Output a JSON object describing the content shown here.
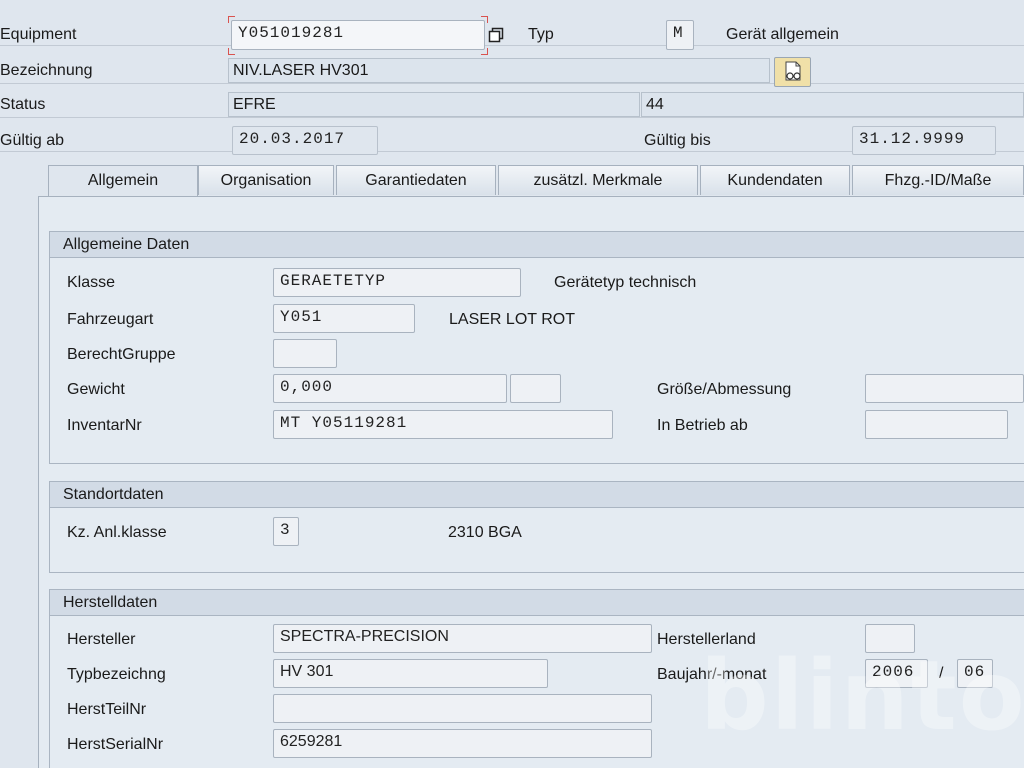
{
  "header": {
    "equipment_label": "Equipment",
    "equipment_value": "Y051019281",
    "typ_label": "Typ",
    "typ_value": "M",
    "typ_text": "Gerät allgemein",
    "bezeichnung_label": "Bezeichnung",
    "bezeichnung_value": "NIV.LASER HV301",
    "status_label": "Status",
    "status_value": "EFRE",
    "status_value2": "44",
    "gueltig_ab_label": "Gültig ab",
    "gueltig_ab_value": "20.03.2017",
    "gueltig_bis_label": "Gültig bis",
    "gueltig_bis_value": "31.12.9999"
  },
  "tabs": [
    {
      "label": "Allgemein",
      "active": true
    },
    {
      "label": "Organisation"
    },
    {
      "label": "Garantiedaten"
    },
    {
      "label": "zusätzl. Merkmale"
    },
    {
      "label": "Kundendaten"
    },
    {
      "label": "Fhzg.-ID/Maße"
    }
  ],
  "allgemeine_daten": {
    "title": "Allgemeine Daten",
    "klasse_label": "Klasse",
    "klasse_value": "GERAETETYP",
    "klasse_text": "Gerätetyp technisch",
    "fahrzeugart_label": "Fahrzeugart",
    "fahrzeugart_value": "Y051",
    "fahrzeugart_text": "LASER LOT ROT",
    "berechtgruppe_label": "BerechtGruppe",
    "berechtgruppe_value": "",
    "gewicht_label": "Gewicht",
    "gewicht_value": "0,000",
    "gewicht_unit": "",
    "groesse_label": "Größe/Abmessung",
    "groesse_value": "",
    "inventar_label": "InventarNr",
    "inventar_value": "MT Y05119281",
    "inbetrieb_label": "In Betrieb ab",
    "inbetrieb_value": ""
  },
  "standortdaten": {
    "title": "Standortdaten",
    "anlklasse_label": "Kz. Anl.klasse",
    "anlklasse_value": "3",
    "anlklasse_text": "2310 BGA"
  },
  "herstelldaten": {
    "title": "Herstelldaten",
    "hersteller_label": "Hersteller",
    "hersteller_value": "SPECTRA-PRECISION",
    "herstellerland_label": "Herstellerland",
    "herstellerland_value": "",
    "typbez_label": "Typbezeichng",
    "typbez_value": "HV 301",
    "baujahr_label": "Baujahr/-monat",
    "baujahr_value": "2006",
    "baujahr_sep": "/",
    "baumonat_value": "06",
    "teilnr_label": "HerstTeilNr",
    "teilnr_value": "",
    "serialnr_label": "HerstSerialNr",
    "serialnr_value": "6259281"
  },
  "watermark": "blinto",
  "icons": {
    "equipment_select": "copy-square-icon",
    "bezeichnung_longtext": "document-glasses-icon"
  },
  "colors": {
    "background": "#dfe6ee",
    "focus_marker": "#d9534f",
    "group_header": "#d2dbe6"
  }
}
